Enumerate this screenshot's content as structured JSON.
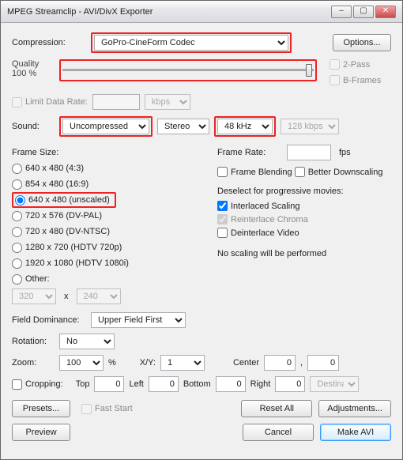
{
  "window": {
    "title": "MPEG Streamclip - AVI/DivX Exporter"
  },
  "compression": {
    "label": "Compression:",
    "value": "GoPro-CineForm Codec"
  },
  "options_btn": "Options...",
  "quality": {
    "label": "Quality",
    "pct_label": "100 %",
    "value": 100
  },
  "ext_opts": {
    "twopass": "2-Pass",
    "bframes": "B-Frames"
  },
  "limit_data_rate": {
    "label": "Limit Data Rate:",
    "unit": "kbps",
    "value": ""
  },
  "sound": {
    "label": "Sound:",
    "codec": "Uncompressed",
    "channels": "Stereo",
    "rate": "48 kHz",
    "bitrate": "128 kbps"
  },
  "frame_size": {
    "label": "Frame Size:",
    "options": [
      {
        "id": "fs0",
        "label": "640 x 480  (4:3)"
      },
      {
        "id": "fs1",
        "label": "854 x 480  (16:9)"
      },
      {
        "id": "fs2",
        "label": "640 x 480  (unscaled)",
        "selected": true
      },
      {
        "id": "fs3",
        "label": "720 x 576  (DV-PAL)"
      },
      {
        "id": "fs4",
        "label": "720 x 480  (DV-NTSC)"
      },
      {
        "id": "fs5",
        "label": "1280 x 720  (HDTV 720p)"
      },
      {
        "id": "fs6",
        "label": "1920 x 1080  (HDTV 1080i)"
      },
      {
        "id": "fs7",
        "label": "Other:"
      }
    ],
    "other_w": "320",
    "other_h": "240"
  },
  "frame_rate": {
    "label": "Frame Rate:",
    "value": "",
    "unit": "fps"
  },
  "frame_blending": "Frame Blending",
  "better_downscaling": "Better Downscaling",
  "deselect_note": "Deselect for progressive movies:",
  "interlaced_scaling": "Interlaced Scaling",
  "reinterlace_chroma": "Reinterlace Chroma",
  "deinterlace_video": "Deinterlace Video",
  "noscaling_note": "No scaling will be performed",
  "field_dominance": {
    "label": "Field Dominance:",
    "value": "Upper Field First"
  },
  "rotation": {
    "label": "Rotation:",
    "value": "No"
  },
  "zoom": {
    "label": "Zoom:",
    "value": "100",
    "pct": "%",
    "xy_label": "X/Y:",
    "xy_value": "1",
    "center_label": "Center",
    "cx": "0",
    "cy": "0"
  },
  "cropping": {
    "label": "Cropping:",
    "top_l": "Top",
    "top": "0",
    "left_l": "Left",
    "left": "0",
    "bottom_l": "Bottom",
    "bottom": "0",
    "right_l": "Right",
    "right": "0",
    "mode": "Destinati"
  },
  "buttons": {
    "presets": "Presets...",
    "faststart": "Fast Start",
    "resetall": "Reset All",
    "adjustments": "Adjustments...",
    "preview": "Preview",
    "cancel": "Cancel",
    "makeavi": "Make AVI"
  }
}
